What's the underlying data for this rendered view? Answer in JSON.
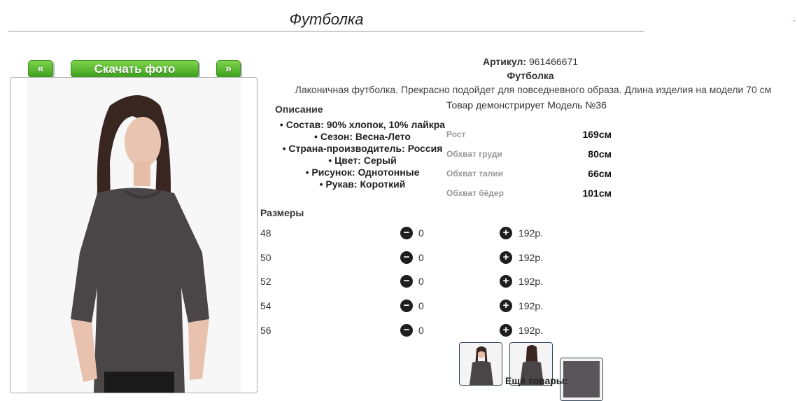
{
  "page_title": "Футболка",
  "nav": {
    "prev_label": "«",
    "download_label": "Скачать фото",
    "next_label": "»"
  },
  "product": {
    "article_label": "Артикул:",
    "article_value": "961466671",
    "name": "Футболка",
    "lead": "Лаконичная футболка. Прекрасно подойдет для повседневного образа. Длина изделия на модели 70 см",
    "model_note": "Товар демонстрирует Модель №36"
  },
  "description": {
    "title": "Описание",
    "items": [
      "Состав: 90% хлопок, 10% лайкра",
      "Сезон: Весна-Лето",
      "Страна-производитель: Россия",
      "Цвет: Серый",
      "Рисунок: Однотонные",
      "Рукав: Короткий"
    ]
  },
  "measurements": [
    {
      "label": "Рост",
      "value": "169см"
    },
    {
      "label": "Обхват груди",
      "value": "80см"
    },
    {
      "label": "Обхват талии",
      "value": "66см"
    },
    {
      "label": "Обхват бёдер",
      "value": "101см"
    }
  ],
  "sizes": {
    "title": "Размеры",
    "rows": [
      {
        "size": "48",
        "qty": "0",
        "price": "192р."
      },
      {
        "size": "50",
        "qty": "0",
        "price": "192р."
      },
      {
        "size": "52",
        "qty": "0",
        "price": "192р."
      },
      {
        "size": "54",
        "qty": "0",
        "price": "192р."
      },
      {
        "size": "56",
        "qty": "0",
        "price": "192р."
      }
    ]
  },
  "more_products": "Ещё товары:",
  "colors": {
    "button_green": "#4cb22a",
    "shirt": "#4a4547",
    "icon": "#1e1e1e"
  },
  "icons": {
    "minus": "minus-circle-icon",
    "plus": "plus-circle-icon"
  }
}
